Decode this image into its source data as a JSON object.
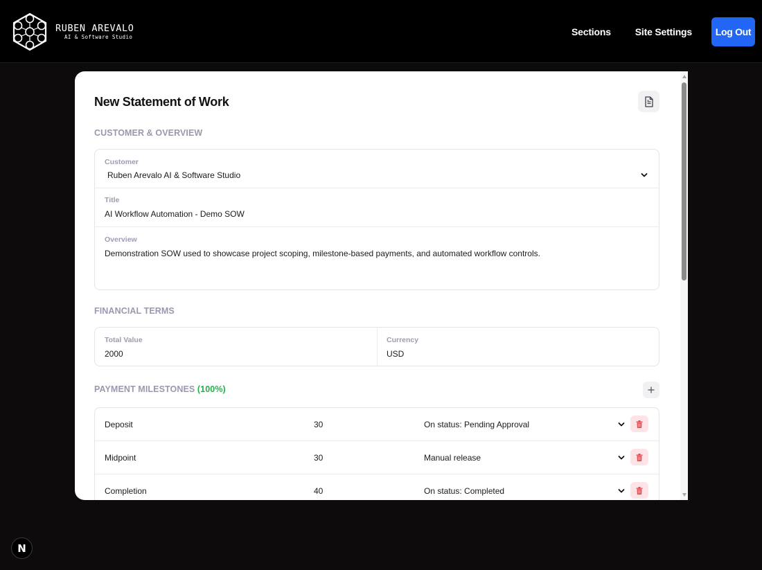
{
  "brand": {
    "name": "RUBEN AREVALO",
    "subtitle": "AI & Software Studio"
  },
  "nav": {
    "sections": "Sections",
    "site_settings": "Site Settings",
    "logout": "Log Out"
  },
  "page_title": "New Statement of Work",
  "customer_overview": {
    "heading": "CUSTOMER & OVERVIEW",
    "customer_label": "Customer",
    "customer_value": "Ruben Arevalo AI & Software Studio",
    "title_label": "Title",
    "title_value": "AI Workflow Automation - Demo SOW",
    "overview_label": "Overview",
    "overview_value": "Demonstration SOW used to showcase project scoping, milestone-based payments, and automated workflow controls."
  },
  "financial_terms": {
    "heading": "FINANCIAL TERMS",
    "total_label": "Total Value",
    "total_value": "2000",
    "currency_label": "Currency",
    "currency_value": "USD"
  },
  "milestones": {
    "heading": "PAYMENT MILESTONES",
    "percent": "(100%)",
    "rows": [
      {
        "name": "Deposit",
        "percent": "30",
        "trigger": "On status: Pending Approval"
      },
      {
        "name": "Midpoint",
        "percent": "30",
        "trigger": "Manual release"
      },
      {
        "name": "Completion",
        "percent": "40",
        "trigger": "On status: Completed"
      }
    ]
  },
  "dev_badge": "N",
  "colors": {
    "accent": "#2166f5",
    "success": "#22b04a",
    "danger": "#e5484d",
    "muted_label": "#9a98ae"
  }
}
